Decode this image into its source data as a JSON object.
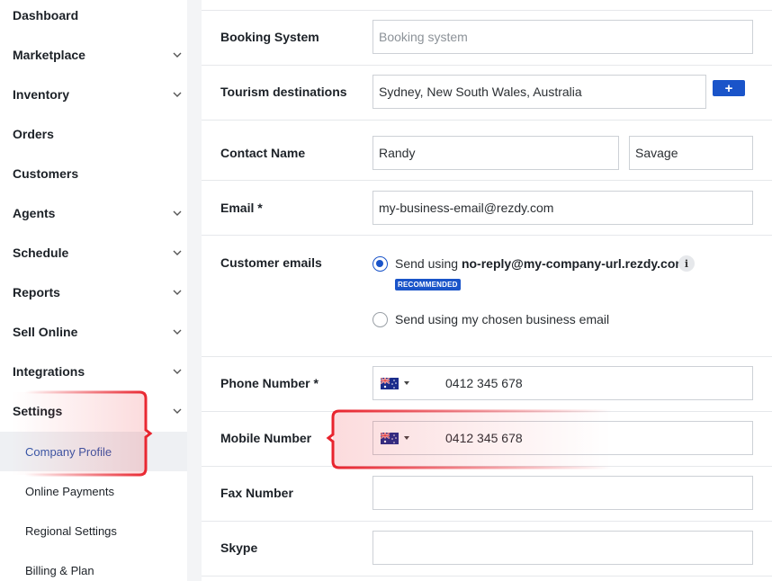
{
  "sidebar": {
    "items": [
      {
        "label": "Dashboard",
        "has_chevron": false
      },
      {
        "label": "Marketplace",
        "has_chevron": true
      },
      {
        "label": "Inventory",
        "has_chevron": true
      },
      {
        "label": "Orders",
        "has_chevron": false
      },
      {
        "label": "Customers",
        "has_chevron": false
      },
      {
        "label": "Agents",
        "has_chevron": true
      },
      {
        "label": "Schedule",
        "has_chevron": true
      },
      {
        "label": "Reports",
        "has_chevron": true
      },
      {
        "label": "Sell Online",
        "has_chevron": true
      },
      {
        "label": "Integrations",
        "has_chevron": true
      },
      {
        "label": "Settings",
        "has_chevron": true
      }
    ],
    "settings_subitems": [
      {
        "label": "Company Profile",
        "active": true
      },
      {
        "label": "Online Payments",
        "active": false
      },
      {
        "label": "Regional Settings",
        "active": false
      },
      {
        "label": "Billing & Plan",
        "active": false
      }
    ]
  },
  "form": {
    "booking_system": {
      "label": "Booking System",
      "placeholder": "Booking system",
      "value": ""
    },
    "tourism_destinations": {
      "label": "Tourism destinations",
      "value": "Sydney, New South Wales, Australia",
      "add_label": "+"
    },
    "contact_name": {
      "label": "Contact Name",
      "first": "Randy",
      "last": "Savage"
    },
    "email": {
      "label": "Email *",
      "value": "my-business-email@rezdy.com"
    },
    "customer_emails": {
      "label": "Customer emails",
      "option1_prefix": "Send using ",
      "option1_address": "no-reply@my-company-url.rezdy.com",
      "option1_selected": true,
      "info": "i",
      "badge": "RECOMMENDED",
      "option2": "Send using my chosen business email",
      "option2_selected": false
    },
    "phone": {
      "label": "Phone Number *",
      "value": "0412 345 678",
      "country": "AU"
    },
    "mobile": {
      "label": "Mobile Number",
      "value": "0412 345 678",
      "country": "AU"
    },
    "fax": {
      "label": "Fax Number",
      "value": ""
    },
    "skype": {
      "label": "Skype",
      "value": ""
    }
  },
  "colors": {
    "accent": "#1a54c9",
    "highlight": "#e8212b",
    "active_sub_text": "#3456a8"
  }
}
